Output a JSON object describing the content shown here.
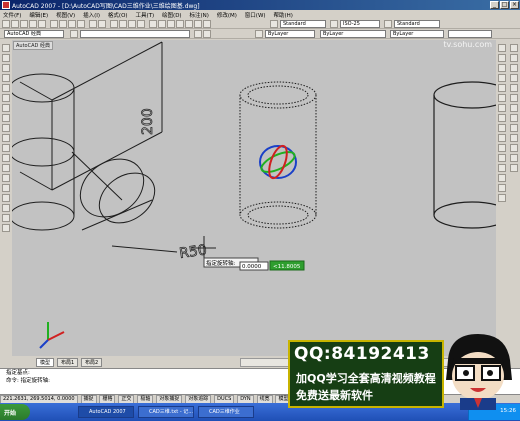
{
  "window": {
    "title": "AutoCAD 2007 - [D:\\AutoCAD写图\\CAD三维作业\\三维绘图基.dwg]",
    "controls": [
      "_",
      "□",
      "×"
    ]
  },
  "menu": [
    "文件(F)",
    "编辑(E)",
    "视图(V)",
    "插入(I)",
    "格式(O)",
    "工具(T)",
    "绘图(D)",
    "标注(N)",
    "修改(M)",
    "窗口(W)",
    "帮助(H)"
  ],
  "toolbars": {
    "layer_combo": "AutoCAD 经典",
    "textstyle_combo": "Standard",
    "dimstyle_combo": "ISO-25",
    "tablestyle_combo": "Standard",
    "color_combo": "ByLayer",
    "linetype_combo": "ByLayer",
    "lineweight_combo": "ByLayer"
  },
  "drawing": {
    "watermark": "tv.sohu.com",
    "viewport_label": "AutoCAD 经典",
    "dimension_200": "200",
    "dimension_r50": "R50",
    "tooltip_text": "指定旋转轴:",
    "tooltip_value": "0.0000",
    "tooltip_angle": "<11.8005"
  },
  "tabs": [
    "模型",
    "布局1",
    "布局2"
  ],
  "command": {
    "line1": "指定基点:",
    "line2": "命令: 指定旋转轴:"
  },
  "status": {
    "coords": "221.2631, 269.5014, 0.0000",
    "buttons": [
      "捕捉",
      "栅格",
      "正交",
      "极轴",
      "对象捕捉",
      "对象追踪",
      "DUCS",
      "DYN",
      "线宽",
      "模型"
    ]
  },
  "taskbar": {
    "start": "开始",
    "tasks": [
      "AutoCAD 2007",
      "CAD三维.txt - 记...",
      "CAD三维作业"
    ],
    "clock": "15:26"
  },
  "ad": {
    "qq": "QQ:84192413",
    "line1": "加QQ学习全套高清视频教程",
    "line2": "免费送最新软件"
  },
  "colors": {
    "drawing_bg": "#c2c2c2",
    "titlebar": "#0a246a",
    "ad_bg": "#163e14",
    "ad_border": "#c8b400"
  }
}
